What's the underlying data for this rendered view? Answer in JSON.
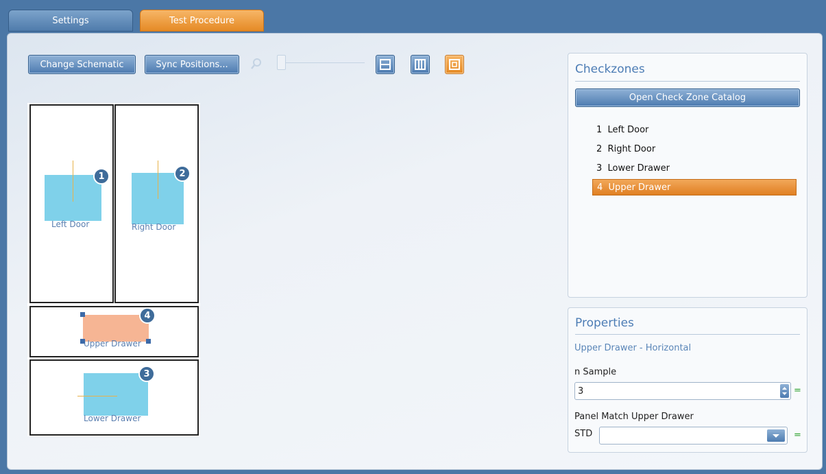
{
  "tabs": [
    {
      "label": "Settings"
    },
    {
      "label": "Test Procedure"
    }
  ],
  "toolbar": {
    "change_schematic": "Change Schematic",
    "sync_positions": "Sync Positions...",
    "zoom_level": 0
  },
  "schematic": {
    "zones": [
      {
        "number": "1",
        "label": "Left Door"
      },
      {
        "number": "2",
        "label": "Right Door"
      },
      {
        "number": "4",
        "label": "Upper Drawer"
      },
      {
        "number": "3",
        "label": "Lower Drawer"
      }
    ]
  },
  "checkzones": {
    "title": "Checkzones",
    "catalog_button": "Open Check Zone Catalog",
    "items": [
      {
        "num": "1",
        "name": "Left Door"
      },
      {
        "num": "2",
        "name": "Right Door"
      },
      {
        "num": "3",
        "name": "Lower Drawer"
      },
      {
        "num": "4",
        "name": "Upper Drawer"
      }
    ],
    "selected_index": 3
  },
  "properties": {
    "title": "Properties",
    "subtitle": "Upper Drawer - Horizontal",
    "n_sample_label": "n Sample",
    "n_sample_value": "3",
    "panel_match_label": "Panel Match Upper Drawer",
    "std_label": "STD",
    "std_value": "",
    "eq": "="
  },
  "colors": {
    "accent_orange": "#e58a25",
    "accent_blue": "#4d7bb0",
    "zone_fill": "#7fd1ea",
    "selected_zone_fill": "#f6b594"
  }
}
